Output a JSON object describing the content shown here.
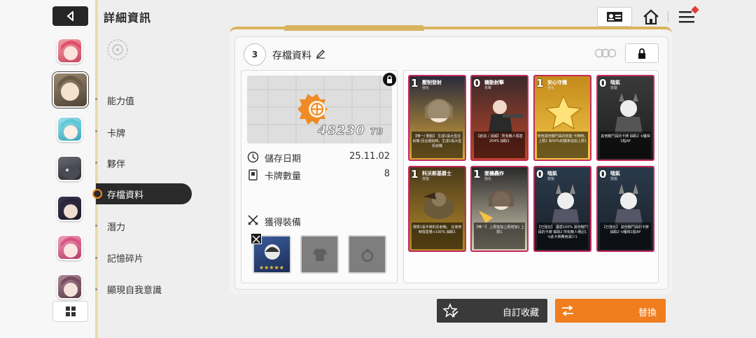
{
  "header": {
    "title": "詳細資訊"
  },
  "nav": {
    "items": [
      "能力值",
      "卡牌",
      "夥伴",
      "存檔資料",
      "潛力",
      "記憶碎片",
      "顯現自我意識"
    ],
    "active": "存檔資料"
  },
  "save": {
    "slot_number": "3",
    "title": "存檔資料",
    "storage_value": "48230",
    "storage_unit": "TB",
    "date_label": "儲存日期",
    "date_value": "25.11.02",
    "card_count_label": "卡牌數量",
    "card_count_value": "8",
    "equipment_label": "獲得裝備"
  },
  "cards": [
    {
      "cost": "1",
      "name": "壓制發射",
      "type": "強化",
      "desc": "【唯一/ 刪除】 生成1張大型反射機 回合開始時，生成1張大型反射機"
    },
    {
      "cost": "0",
      "name": "機動射擊",
      "type": "攻擊",
      "desc": "【創造 / 消滅】 所有敵人傷害204% 抽取1"
    },
    {
      "cost": "1",
      "name": "安心守護",
      "type": "強化",
      "desc": "使用其他戰鬥員的技能 卡牌時，上限1 有50%的機率追加上限1"
    },
    {
      "cost": "0",
      "name": "喘氣",
      "type": "技能",
      "desc": "其他戰鬥員的卡牌 抽取2 ⟲獲得1點AP"
    },
    {
      "cost": "1",
      "name": "科沃斯基爵士",
      "type": "技能",
      "desc": "選擇1張手牌的反射機， 在使用時傷害量+100% 抽取1"
    },
    {
      "cost": "1",
      "name": "墜機轟炸",
      "type": "強化",
      "desc": "【唯一】 上限追加上限增加1 上限1"
    },
    {
      "cost": "0",
      "name": "喘氣",
      "type": "技能",
      "desc": "【已強化】 護盾100% 其他戰鬥員的卡牌 抽取2 所有敵人傳記1 ⟲此卡牌費用減少1"
    },
    {
      "cost": "0",
      "name": "喘氣",
      "type": "技能",
      "desc": "【已強化】 其他戰鬥員的卡牌 抽取2 ⟲獲得1點AP"
    }
  ],
  "buttons": {
    "collect": "自訂收藏",
    "replace": "替換"
  },
  "colors": {
    "accent": "#f07d1e",
    "dark": "#2a2a2a",
    "gold": "#d9b45e",
    "card_border": "#c8235f"
  }
}
